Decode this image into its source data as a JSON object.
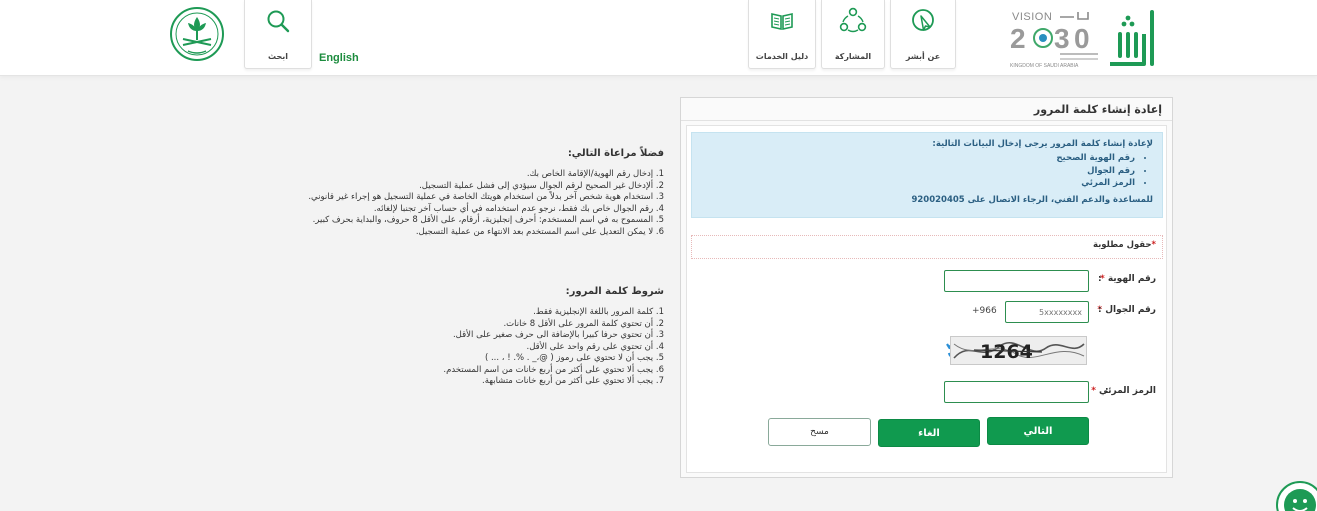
{
  "header": {
    "search": {
      "label": "ابحث",
      "icon": "search-icon"
    },
    "language": {
      "label": "English"
    },
    "nav": [
      {
        "label": "دليل الخدمات",
        "icon": "book-icon"
      },
      {
        "label": "المشاركة",
        "icon": "share-icon"
      },
      {
        "label": "عن أبشر",
        "icon": "pointer-icon"
      }
    ],
    "logos": {
      "emblem": "emblem-icon",
      "vision": "VISION 2030 logo",
      "absher": "absher-logo"
    }
  },
  "panel": {
    "title": "إعادة إنشاء كلمة المرور",
    "info": {
      "intro": "لإعادة إنشاء كلمة المرور يرجى إدخال البيانات التالية:",
      "items": [
        "رقم الهوية الصحيح",
        "رقم الجوال",
        "الرمز المرئي"
      ],
      "support": "للمساعدة والدعم الفني، الرجاء الاتصال على 920020405"
    },
    "required_note": "حقول مطلوبة",
    "fields": {
      "id_label": "رقم الهوية",
      "id_value": "",
      "mobile_label": "رقم الجوال",
      "mobile_prefix": "+966",
      "mobile_placeholder": "5xxxxxxxx",
      "captcha_text": "1264",
      "captcha_label": "الرمز المرئي",
      "captcha_value": ""
    },
    "buttons": {
      "next": "التالي",
      "cancel": "الغاء",
      "clear": "مسح"
    }
  },
  "notes": {
    "consider_title": "فضلاً مراعاة التالي:",
    "consider_items": [
      "1. إدخال رقم الهوية/الإقامة الخاص بك.",
      "2. ألإدخال غير الصحيح لرقم الجوال سيؤدي إلى فشل عملية التسجيل.",
      "3. استخدام هوية شخص آخر بدلاً من استخدام هويتك الخاصة في عملية التسجيل هو إجراء غير قانوني.",
      "4. رقم الجوال خاص بك فقط، نرجو عدم استخدامه في أي حساب آخر تجنبا لإلغائه.",
      "5. المسموح به في اسم المستخدم: أحرف إنجليزية، أرقام، على الأقل 8 حروف، والبداية بحرف كبير.",
      "6. لا يمكن التعديل على اسم المستخدم بعد الانتهاء من عملية التسجيل."
    ],
    "password_title": "شروط كلمة المرور:",
    "password_items": [
      "1. كلمة المرور باللغة الإنجليزية فقط.",
      "2. أن تحتوي كلمة المرور على الأقل 8 خانات.",
      "3. أن تحتوي حرفا كبيرا بالإضافة الى حرف صغير على الأقل.",
      "4. أن تحتوي على رقم واحد على الأقل.",
      "5. يجب أن لا تحتوي على رموز ( @،_ . %. ! ، ... )",
      "6. يجب ألا تحتوي على أكثر من أربع خانات من اسم المستخدم.",
      "7. يجب ألا تحتوي على أكثر من أربع خانات متشابهة."
    ]
  },
  "colors": {
    "brand_green": "#109a4f",
    "info_bg": "#d9edf7",
    "info_text": "#2b5f82",
    "required_star": "#cc1f1f"
  }
}
